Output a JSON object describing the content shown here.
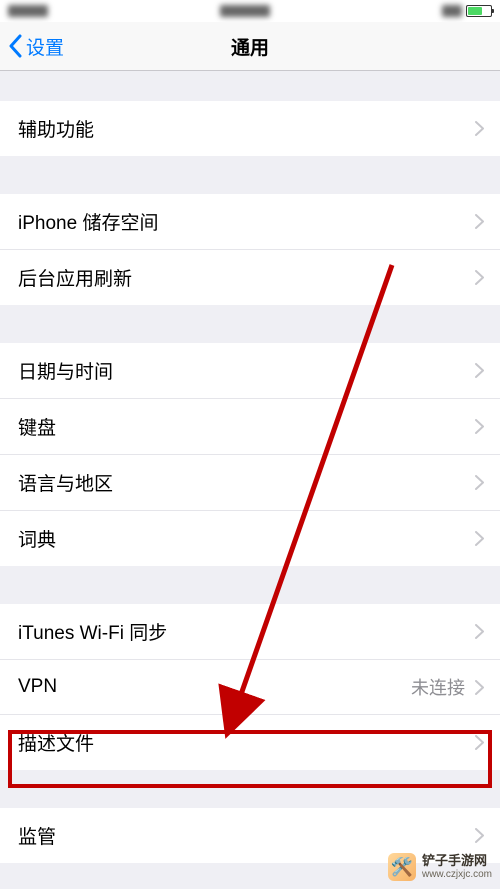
{
  "statusBar": {
    "left": "•••",
    "center": "•••",
    "right": "•••"
  },
  "nav": {
    "back": "设置",
    "title": "通用"
  },
  "groups": [
    {
      "rows": [
        {
          "label": "辅助功能",
          "detail": ""
        }
      ]
    },
    {
      "rows": [
        {
          "label": "iPhone 储存空间",
          "detail": ""
        },
        {
          "label": "后台应用刷新",
          "detail": ""
        }
      ]
    },
    {
      "rows": [
        {
          "label": "日期与时间",
          "detail": ""
        },
        {
          "label": "键盘",
          "detail": ""
        },
        {
          "label": "语言与地区",
          "detail": ""
        },
        {
          "label": "词典",
          "detail": ""
        }
      ]
    },
    {
      "rows": [
        {
          "label": "iTunes Wi-Fi 同步",
          "detail": ""
        },
        {
          "label": "VPN",
          "detail": "未连接"
        },
        {
          "label": "描述文件",
          "detail": ""
        }
      ]
    },
    {
      "rows": [
        {
          "label": "监管",
          "detail": ""
        }
      ]
    }
  ],
  "annotation": {
    "highlight_row_label": "描述文件",
    "arrow_color": "#c10000",
    "box_color": "#c10000"
  },
  "watermark": {
    "name": "铲子手游网",
    "url": "www.czjxjc.com"
  }
}
